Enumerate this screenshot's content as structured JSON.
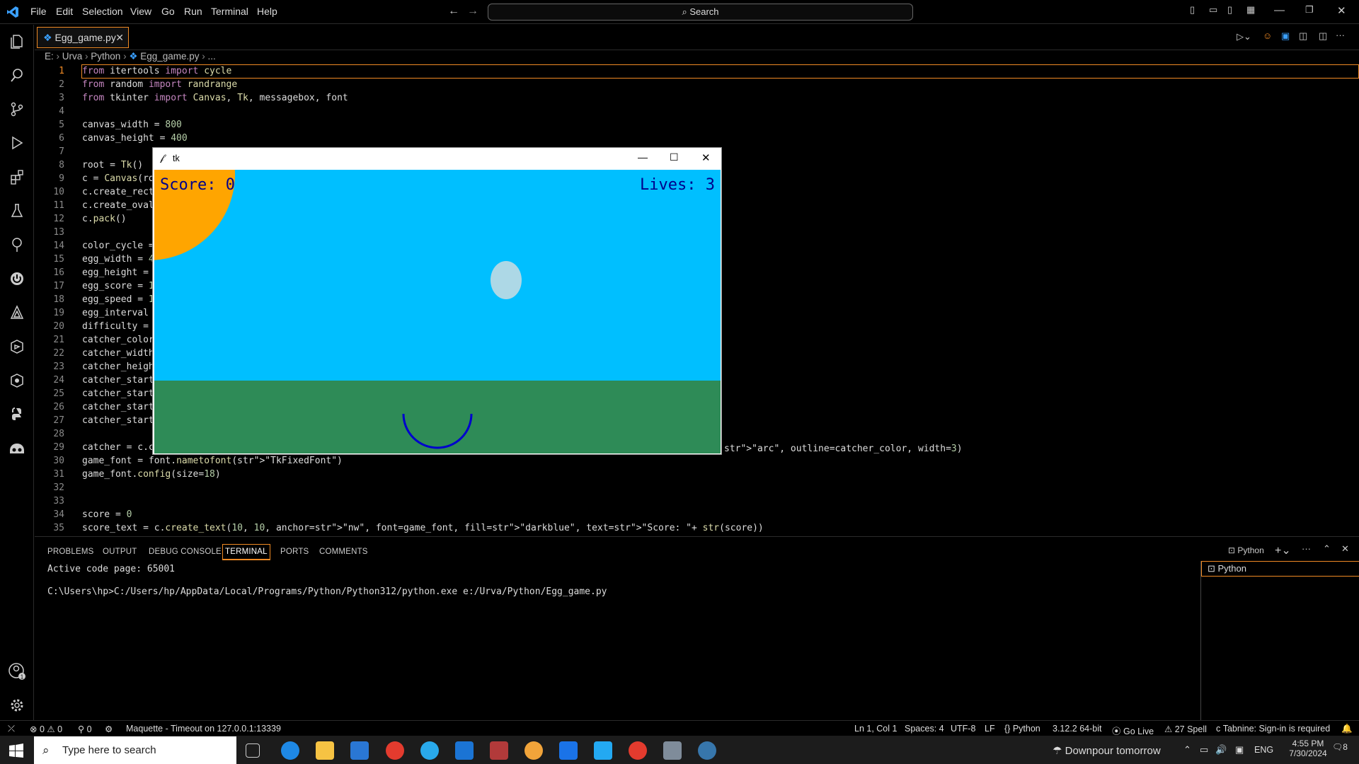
{
  "menu": [
    "File",
    "Edit",
    "Selection",
    "View",
    "Go",
    "Run",
    "Terminal",
    "Help"
  ],
  "search": {
    "label": "Search"
  },
  "tab": {
    "label": "Egg_game.py"
  },
  "breadcrumb": [
    "E:",
    "Urva",
    "Python",
    "Egg_game.py",
    "..."
  ],
  "editor": {
    "line_numbers": [
      "1",
      "2",
      "3",
      "4",
      "5",
      "6",
      "7",
      "8",
      "9",
      "10",
      "11",
      "12",
      "13",
      "14",
      "15",
      "16",
      "17",
      "18",
      "19",
      "20",
      "21",
      "22",
      "23",
      "24",
      "25",
      "26",
      "27",
      "28",
      "29",
      "30",
      "31",
      "32",
      "33",
      "34",
      "35"
    ],
    "lines": [
      "from itertools import cycle",
      "from random import randrange",
      "from tkinter import Canvas, Tk, messagebox, font",
      "",
      "canvas_width = 800",
      "canvas_height = 400",
      "",
      "root = Tk()",
      "c = Canvas(ro",
      "c.create_rect",
      "c.create_oval",
      "c.pack()",
      "",
      "color_cycle =",
      "egg_width = 4",
      "egg_height =",
      "egg_score = 1",
      "egg_speed = 1",
      "egg_interval",
      "difficulty =",
      "catcher_color",
      "catcher_width",
      "catcher_heigh",
      "catcher_start",
      "catcher_start",
      "catcher_start",
      "catcher_start",
      "",
      "catcher = c.c",
      "game_font = font.nametofont(\"TkFixedFont\")",
      "game_font.config(size=18)",
      "",
      "",
      "score = 0",
      "score_text = c.create_text(10, 10, anchor=\"nw\", font=game_font, fill=\"darkblue\", text=\"Score: \"+ str(score))"
    ],
    "line29_tail": "\"arc\", outline=catcher_color, width=3)"
  },
  "tk_window": {
    "title": "tk",
    "score_text": "Score: 0",
    "lives_text": "Lives: 3",
    "colors": {
      "sky": "#00bfff",
      "grass": "#2e8b57",
      "sun": "#ffa500",
      "egg": "#add8e6",
      "catcher": "#0000cd",
      "text": "#00008b"
    }
  },
  "panel": {
    "tabs": [
      "PROBLEMS",
      "OUTPUT",
      "DEBUG CONSOLE",
      "TERMINAL",
      "PORTS",
      "COMMENTS"
    ],
    "active_tab": "TERMINAL",
    "terminal_lines": [
      "Active code page: 65001",
      "",
      "C:\\Users\\hp>C:/Users/hp/AppData/Local/Programs/Python/Python312/python.exe e:/Urva/Python/Egg_game.py"
    ],
    "terminal_name": "Python",
    "terminal_list_item": "Python"
  },
  "status": {
    "errors": "0",
    "warnings": "0",
    "ports": "0",
    "maquette": "Maquette - Timeout on 127.0.0.1:13339",
    "position": "Ln 1, Col 1",
    "spaces": "Spaces: 4",
    "encoding": "UTF-8",
    "eol": "LF",
    "language": "Python",
    "interpreter": "3.12.2 64-bit",
    "golive": "Go Live",
    "spell": "27 Spell",
    "tabnine": "Tabnine: Sign-in is required"
  },
  "taskbar": {
    "search_placeholder": "Type here to search",
    "weather": "Downpour tomorrow",
    "lang": "ENG",
    "time": "4:55 PM",
    "date": "7/30/2024",
    "notif_count": "8"
  }
}
